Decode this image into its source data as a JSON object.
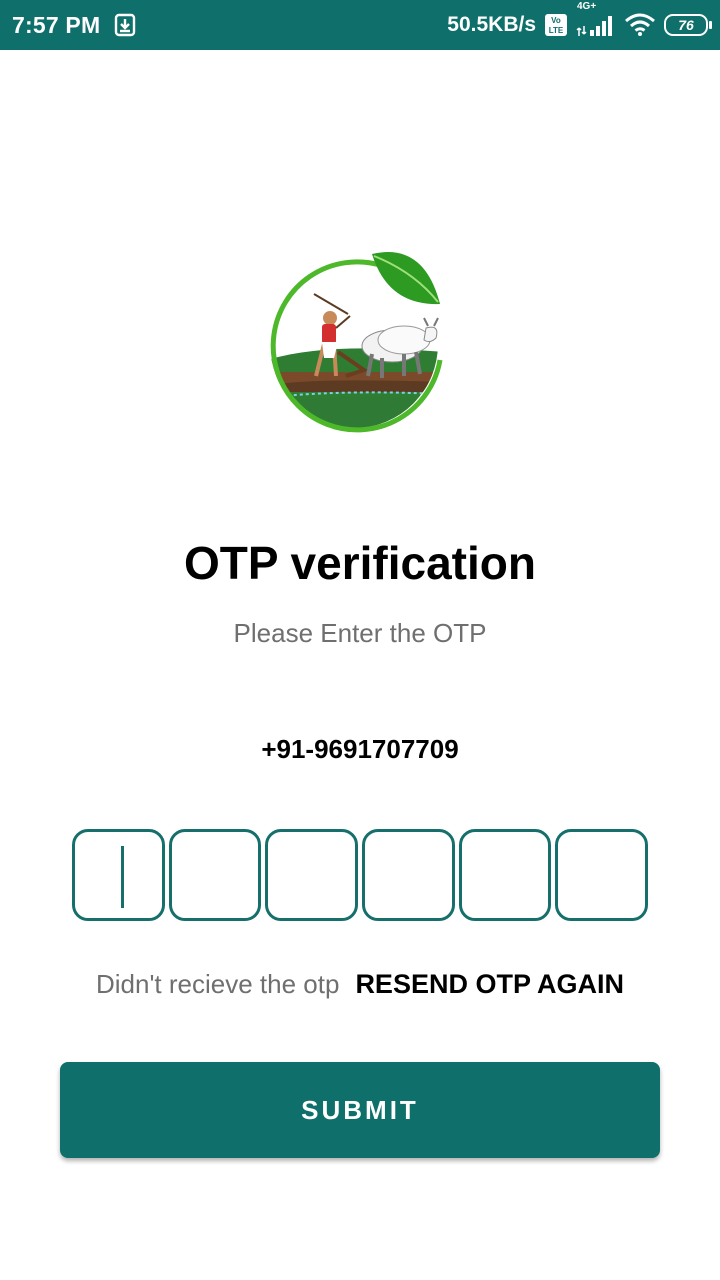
{
  "status_bar": {
    "time": "7:57 PM",
    "network_speed": "50.5KB/s",
    "volte_label": "Vo LTE",
    "network_type": "4G+",
    "battery_level": "76",
    "icons": [
      "download-notification-icon",
      "volte-icon",
      "cell-signal-icon",
      "wifi-icon",
      "battery-icon"
    ]
  },
  "logo": {
    "icon": "farmer-plowing-logo",
    "colors": {
      "ring": "#4cb82a",
      "leaf": "#2d9a22",
      "field": "#2e7d32"
    }
  },
  "header": {
    "title": "OTP verification",
    "subtitle": "Please Enter the OTP"
  },
  "phone_number": "+91-9691707709",
  "otp": {
    "digits": [
      "",
      "",
      "",
      "",
      "",
      ""
    ],
    "focused_index": 0
  },
  "resend": {
    "prompt": "Didn't recieve the otp",
    "link_label": "RESEND OTP AGAIN"
  },
  "submit_label": "SUBMIT",
  "colors": {
    "primary": "#0f6f6a",
    "box_border": "#176f6c",
    "muted_text": "#6f6f6f"
  }
}
